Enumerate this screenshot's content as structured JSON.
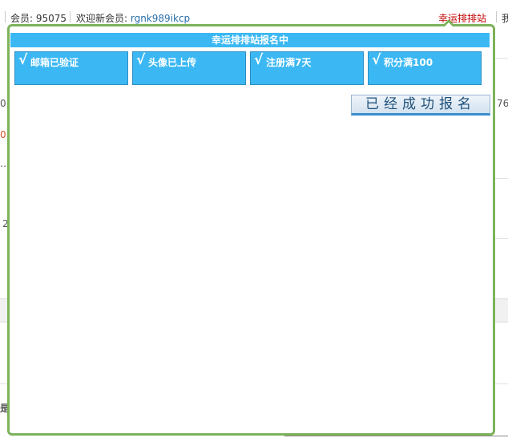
{
  "topbar": {
    "members_label": "会员: 95075",
    "welcome_label": "欢迎新会员: ",
    "new_member": "rgnk989ikcp",
    "lucky_link": "幸运排排站",
    "more_link": "我"
  },
  "background": {
    "row1_left": "0",
    "row1_right": "76",
    "row2_left": "0",
    "row3_left": "…",
    "row4_left": "2",
    "row5_left": "是"
  },
  "popup": {
    "title": "幸运排排站报名中",
    "check_mark": "√",
    "conditions": [
      {
        "label": "邮箱已验证"
      },
      {
        "label": "头像已上传"
      },
      {
        "label": "注册满7天"
      },
      {
        "label": "积分满100"
      }
    ],
    "status_button": "已经成功报名"
  },
  "colors": {
    "popup_border": "#7cb35a",
    "accent_blue": "#3bb8f3",
    "lucky_red": "#c00000"
  }
}
